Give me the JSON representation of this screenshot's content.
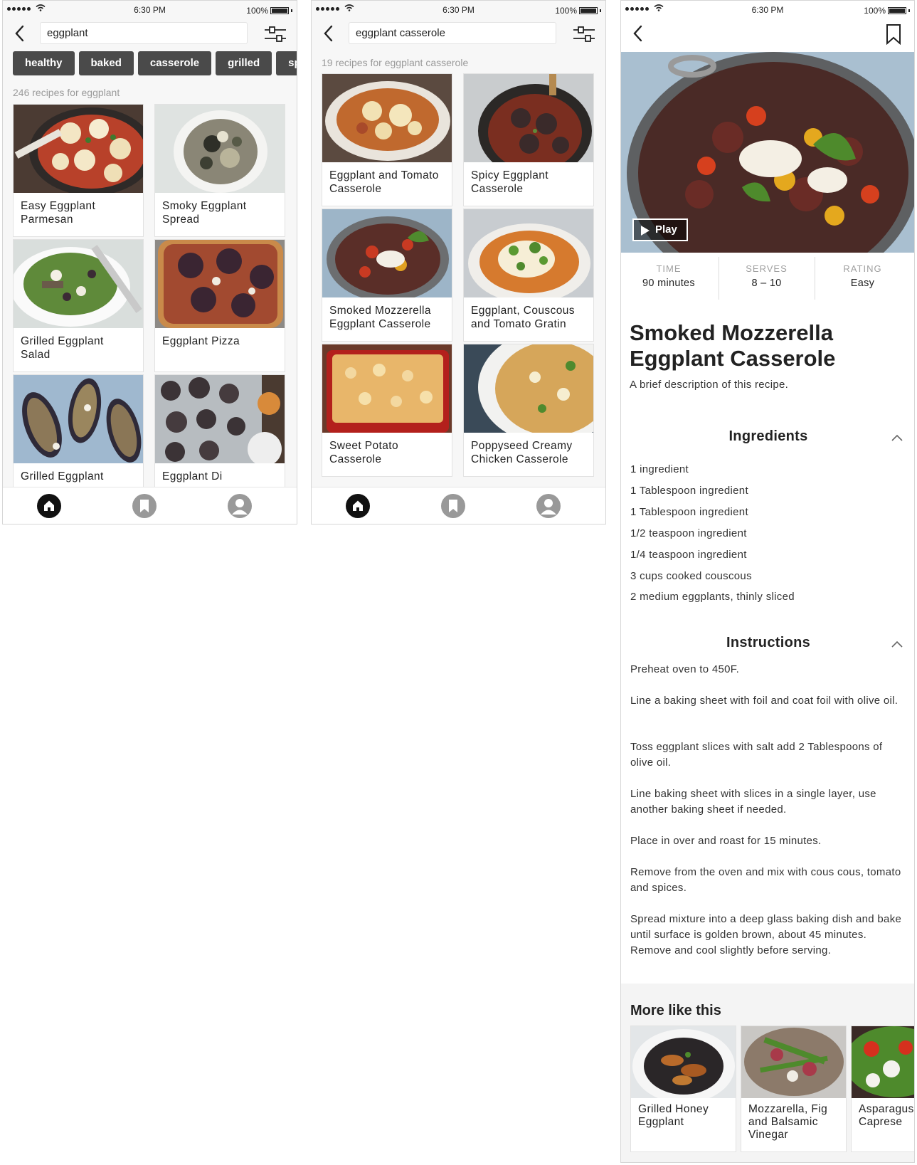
{
  "status": {
    "time": "6:30 PM",
    "battery": "100%"
  },
  "colors": {
    "chip_bg": "#4a4a4a",
    "tab_active": "#111111",
    "tab_inactive": "#999999",
    "muted_text": "#9a9a9a"
  },
  "screen1": {
    "search_value": "eggplant",
    "chips": [
      "healthy",
      "baked",
      "casserole",
      "grilled",
      "sp"
    ],
    "result_count": "246 recipes for eggplant",
    "cards": [
      {
        "title": "Easy Eggplant Parmesan",
        "image": "skillet-parmesan"
      },
      {
        "title": "Smoky Eggplant Spread",
        "image": "bowl-spread"
      },
      {
        "title": "Grilled Eggplant Salad",
        "image": "plate-salad"
      },
      {
        "title": "Eggplant Pizza",
        "image": "pizza"
      },
      {
        "title": "Grilled Eggplant",
        "image": "stuffed-eggplant"
      },
      {
        "title": "Eggplant Di",
        "image": "roasted-slices"
      }
    ]
  },
  "screen2": {
    "search_value": "eggplant casserole",
    "result_count": "19 recipes for eggplant casserole",
    "cards": [
      {
        "title": "Eggplant and Tomato Casserole",
        "image": "oval-dish"
      },
      {
        "title": "Spicy Eggplant Casserole",
        "image": "skillet-dark"
      },
      {
        "title": "Smoked Mozzerella Eggplant Casserole",
        "image": "pan-tomatoes"
      },
      {
        "title": "Eggplant, Couscous and Tomato Gratin",
        "image": "gratin-herbs"
      },
      {
        "title": "Sweet Potato Casserole",
        "image": "red-dish"
      },
      {
        "title": "Poppyseed Creamy Chicken Casserole",
        "image": "white-dish"
      }
    ]
  },
  "tabs": [
    "home-icon",
    "bookmark-icon",
    "profile-icon"
  ],
  "detail": {
    "play_label": "Play",
    "stats": [
      {
        "label": "TIME",
        "value": "90 minutes"
      },
      {
        "label": "SERVES",
        "value": "8 – 10"
      },
      {
        "label": "RATING",
        "value": "Easy"
      }
    ],
    "title_line1": "Smoked Mozzerella",
    "title_line2": "Eggplant Casserole",
    "description": "A brief description of this recipe.",
    "ingredients_heading": "Ingredients",
    "ingredients": [
      "1 ingredient",
      "1 Tablespoon ingredient",
      "1 Tablespoon ingredient",
      "1/2 teaspoon ingredient",
      "1/4 teaspoon ingredient",
      "3 cups cooked couscous",
      "2 medium eggplants, thinly sliced"
    ],
    "instructions_heading": "Instructions",
    "instructions": [
      "Preheat oven to 450F.",
      "Line a baking sheet with foil and coat foil with olive oil.",
      "Toss eggplant slices with salt add 2 Tablespoons of olive oil.",
      "Line baking sheet with slices in a single layer, use another baking sheet if needed.",
      "Place in over and roast for 15 minutes.",
      "Remove from the oven and mix with cous cous, tomato and spices.",
      "Spread mixture into a deep glass baking dish and bake until surface is golden brown, about 45 minutes. Remove and cool slightly before serving."
    ],
    "more_heading": "More like this",
    "more": [
      {
        "title": "Grilled Honey Eggplant",
        "image": "honey-eggplant"
      },
      {
        "title": "Mozzarella, Fig and Balsamic Vinegar",
        "image": "fig-salad"
      },
      {
        "title": "Asparagus Caprese",
        "image": "caprese"
      }
    ]
  }
}
